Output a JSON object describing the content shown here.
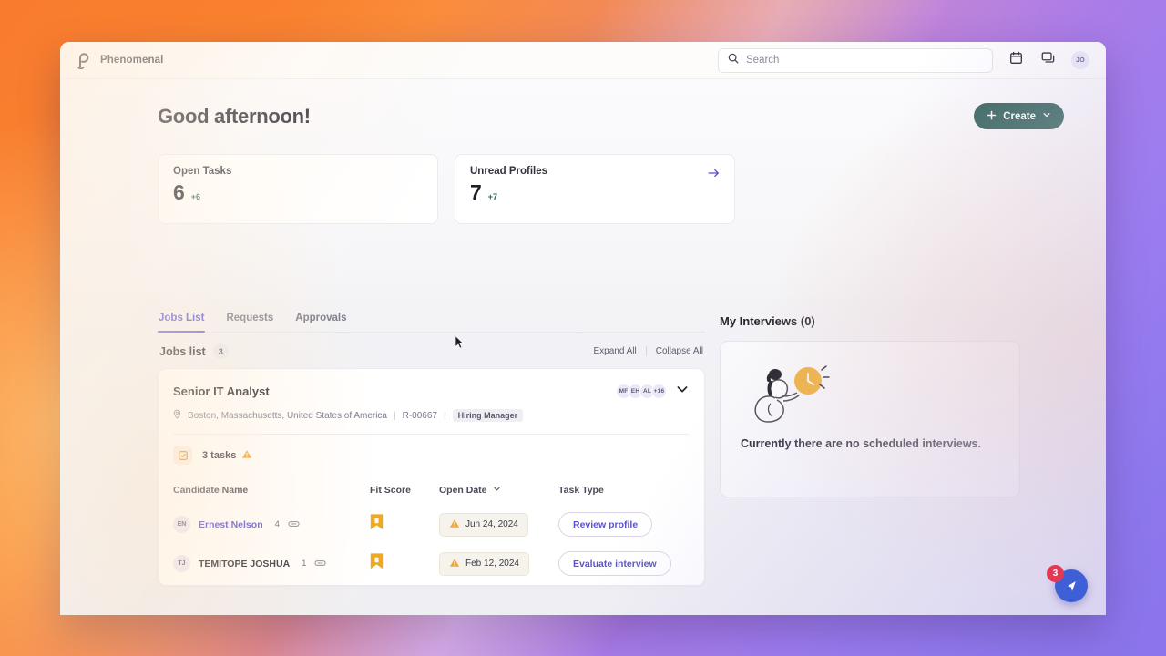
{
  "app": {
    "brand_name": "Phenomenal",
    "logo_icon": "phenomenal-p-logo"
  },
  "topbar": {
    "search_placeholder": "Search",
    "search_value": "",
    "search_icon": "search-icon",
    "calendar_icon": "calendar-icon",
    "messages_icon": "chat-bubbles-icon",
    "avatar_initials": "JO"
  },
  "hero": {
    "greeting": "Good afternoon!",
    "create_label": "Create",
    "create_plus_icon": "plus-icon",
    "create_chevron_icon": "chevron-down-icon",
    "create_color": "#2d6159",
    "cards": [
      {
        "title": "Open Tasks",
        "value": "6",
        "delta": "+6",
        "has_arrow": false
      },
      {
        "title": "Unread Profiles",
        "value": "7",
        "delta": "+7",
        "has_arrow": true,
        "arrow_icon": "arrow-right-icon"
      }
    ]
  },
  "tabs": [
    {
      "label": "Jobs List",
      "active": true
    },
    {
      "label": "Requests",
      "active": false
    },
    {
      "label": "Approvals",
      "active": false
    }
  ],
  "jobs_list": {
    "title": "Jobs list",
    "count": "3",
    "expand_all": "Expand All",
    "collapse_all": "Collapse All",
    "job": {
      "title": "Senior IT Analyst",
      "location_icon": "location-pin-icon",
      "location": "Boston, Massachusetts, United States of America",
      "req_id": "R-00667",
      "role_tag": "Hiring Manager",
      "avatars": [
        "MF",
        "EH",
        "AL"
      ],
      "avatar_overflow": "+16",
      "chevron_icon": "chevron-down-icon",
      "tasks_icon": "task-checklist-icon",
      "tasks_label": "3 tasks",
      "tasks_warning_icon": "warning-triangle-icon"
    },
    "table": {
      "columns": [
        "Candidate Name",
        "Fit Score",
        "Open Date",
        "Task Type"
      ],
      "sort_column": "Open Date",
      "sort_icon": "chevron-down-icon",
      "rows": [
        {
          "initials": "EN",
          "name": "Ernest Nelson",
          "attachments": "4",
          "attachment_icon": "paperclip-icon",
          "fit_score": "0",
          "fit_score_icon": "bookmark-flag-icon",
          "open_date": "Jun 24, 2024",
          "date_warning_icon": "warning-triangle-icon",
          "task_type": "Review profile"
        },
        {
          "initials": "TJ",
          "name": "TEMITOPE JOSHUA",
          "attachments": "1",
          "attachment_icon": "paperclip-icon",
          "fit_score": "0",
          "fit_score_icon": "bookmark-flag-icon",
          "open_date": "Feb 12, 2024",
          "date_warning_icon": "warning-triangle-icon",
          "task_type": "Evaluate interview"
        }
      ]
    }
  },
  "my_interviews": {
    "title": "My Interviews (0)",
    "illustration": "woman-holding-clock-illustration",
    "empty_message": "Currently there are no scheduled interviews."
  },
  "fab": {
    "icon": "send-paper-plane-icon",
    "badge_count": "3",
    "color": "#3f5fd6",
    "badge_color": "#e23a54"
  },
  "cursor": {
    "icon": "mouse-pointer-icon"
  }
}
